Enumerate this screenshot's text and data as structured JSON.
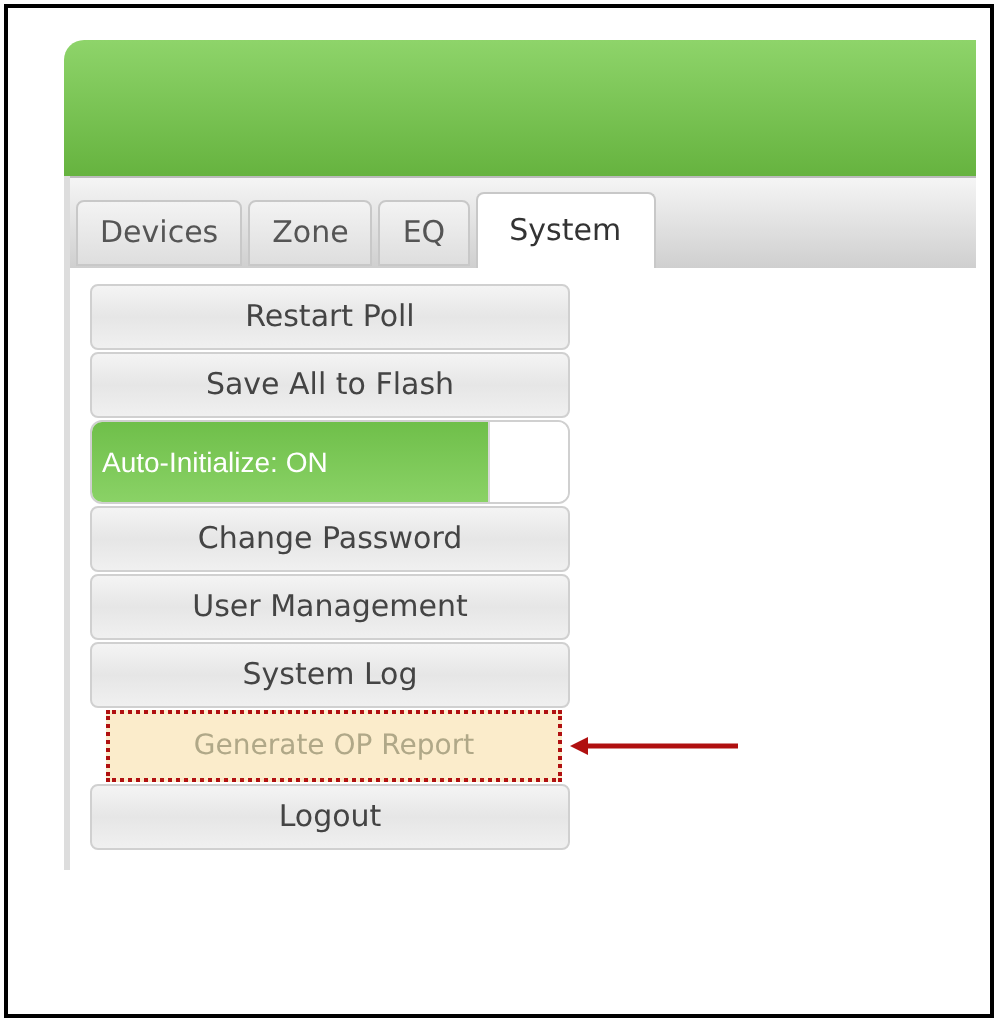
{
  "tabs": [
    {
      "label": "Devices",
      "selected": false
    },
    {
      "label": "Zone",
      "selected": false
    },
    {
      "label": "EQ",
      "selected": false
    },
    {
      "label": "System",
      "selected": true
    }
  ],
  "menu": [
    {
      "kind": "button",
      "label": "Restart Poll"
    },
    {
      "kind": "button",
      "label": "Save All to Flash"
    },
    {
      "kind": "toggle",
      "label": "Auto-Initialize: ON",
      "on": true
    },
    {
      "kind": "button",
      "label": "Change Password"
    },
    {
      "kind": "button",
      "label": "User Management"
    },
    {
      "kind": "button",
      "label": "System Log"
    },
    {
      "kind": "highlighted",
      "label": "Generate OP Report"
    },
    {
      "kind": "button",
      "label": "Logout"
    }
  ]
}
